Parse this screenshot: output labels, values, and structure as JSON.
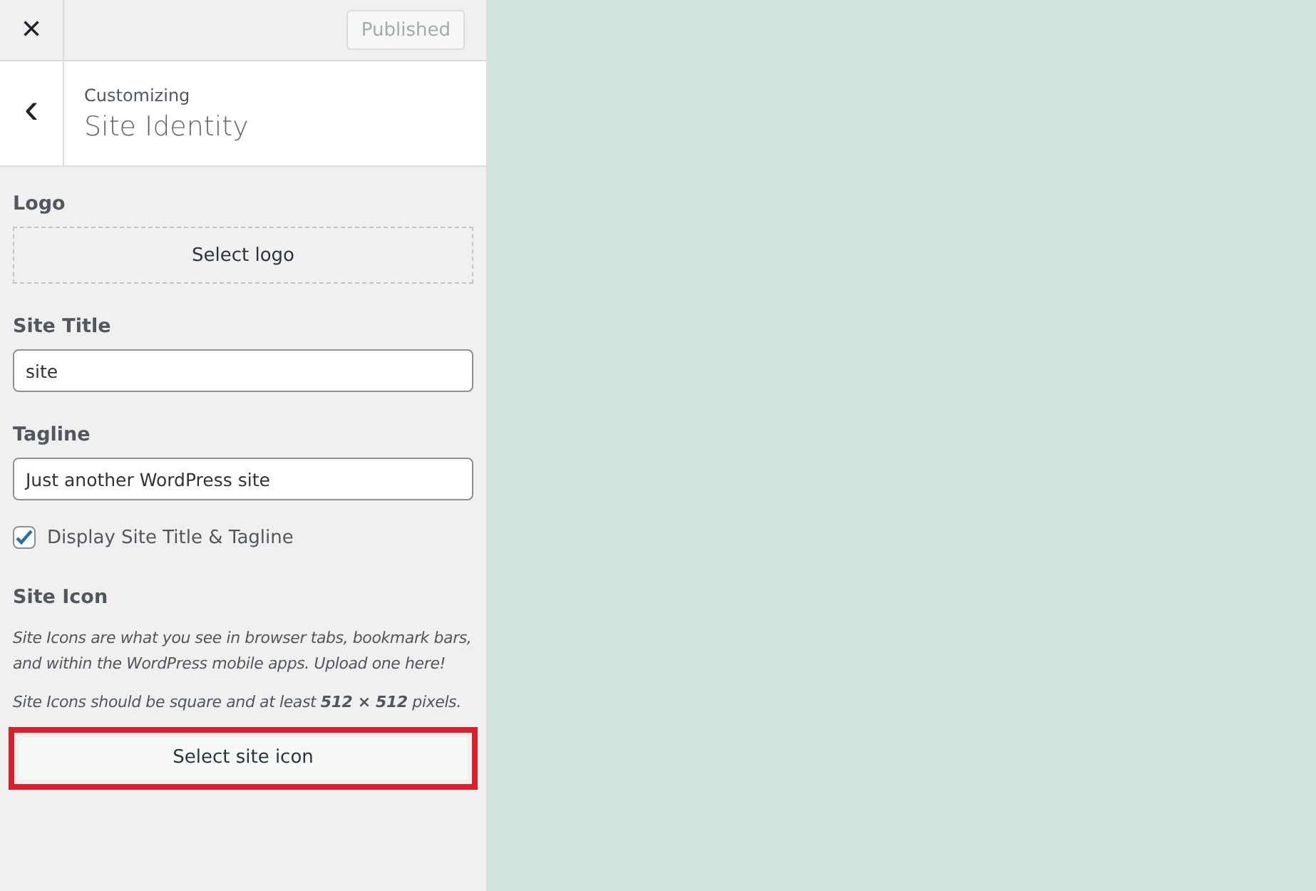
{
  "header": {
    "close": "×",
    "publish_button": {
      "label": "Published",
      "disabled": true
    }
  },
  "section": {
    "back": "‹",
    "breadcrumb": "Customizing",
    "title": "Site Identity"
  },
  "logo": {
    "label": "Logo",
    "button": "Select logo"
  },
  "fields": [
    {
      "label": "Site Title",
      "value": "site"
    },
    {
      "label": "Tagline",
      "value": "Just another WordPress site"
    }
  ],
  "display_title": {
    "label": "Display Site Title & Tagline",
    "checked": true
  },
  "site_icon": {
    "label": "Site Icon",
    "descriptions": [
      "Site Icons are what you see in browser tabs, bookmark bars, and within the WordPress mobile apps. Upload one here!",
      "Site Icons should be square and at least **512 × 512** pixels."
    ],
    "button": {
      "label": "Select site icon",
      "highlighted": true
    }
  }
}
